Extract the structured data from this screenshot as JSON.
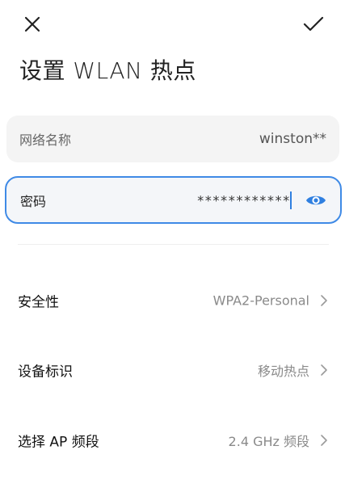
{
  "header": {
    "close_icon": "close-icon",
    "confirm_icon": "check-icon",
    "title": "设置 WLAN 热点"
  },
  "form": {
    "network_name": {
      "label": "网络名称",
      "value": "winston**"
    },
    "password": {
      "label": "密码",
      "value": "************",
      "visibility_icon": "eye-icon"
    }
  },
  "settings": [
    {
      "label": "安全性",
      "value": "WPA2-Personal"
    },
    {
      "label": "设备标识",
      "value": "移动热点"
    },
    {
      "label": "选择 AP 频段",
      "value": "2.4 GHz 频段"
    }
  ],
  "colors": {
    "accent": "#2f7fe0",
    "focus_border": "#3f8ae6",
    "field_background": "#f4f4f4",
    "secondary_text": "#8a8a8a"
  }
}
